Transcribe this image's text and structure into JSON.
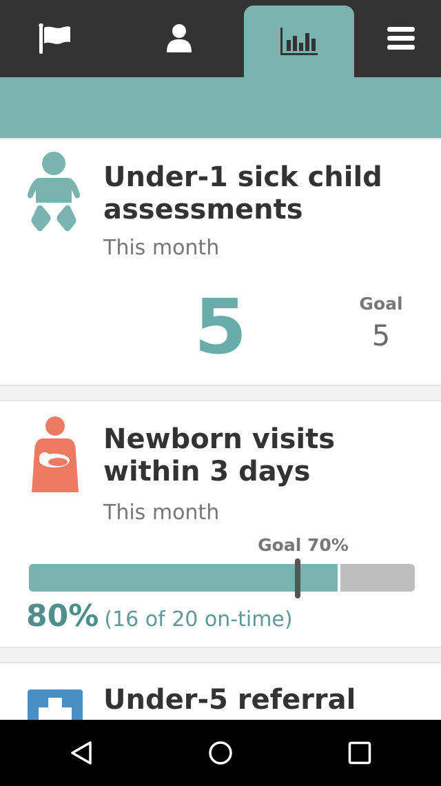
{
  "tabs": [
    {
      "icon": "flag-icon",
      "active": false
    },
    {
      "icon": "person-icon",
      "active": false
    },
    {
      "icon": "bar-chart-icon",
      "active": true
    },
    {
      "icon": "menu-icon",
      "active": false
    }
  ],
  "colors": {
    "accent": "#7ab3b0",
    "accent_dark": "#4f8e8b",
    "coral": "#ef7a64",
    "blue": "#4a8fc3",
    "topbar": "#333333"
  },
  "cards": [
    {
      "icon": "baby-icon",
      "title": "Under-1 sick child assessments",
      "subtitle": "This month",
      "count": "5",
      "goal_label": "Goal",
      "goal_value": "5"
    },
    {
      "icon": "mother-newborn-icon",
      "title": "Newborn visits within 3 days",
      "subtitle": "This month",
      "goal_label": "Goal 70%",
      "goal_fraction": 0.7,
      "progress_fraction": 0.8,
      "percent": "80%",
      "detail": "(16 of 20 on-time)"
    },
    {
      "icon": "medical-cross-icon",
      "title": "Under-5 referral"
    }
  ],
  "system_nav": {
    "back": "back-icon",
    "home": "home-icon",
    "recents": "recents-icon"
  }
}
